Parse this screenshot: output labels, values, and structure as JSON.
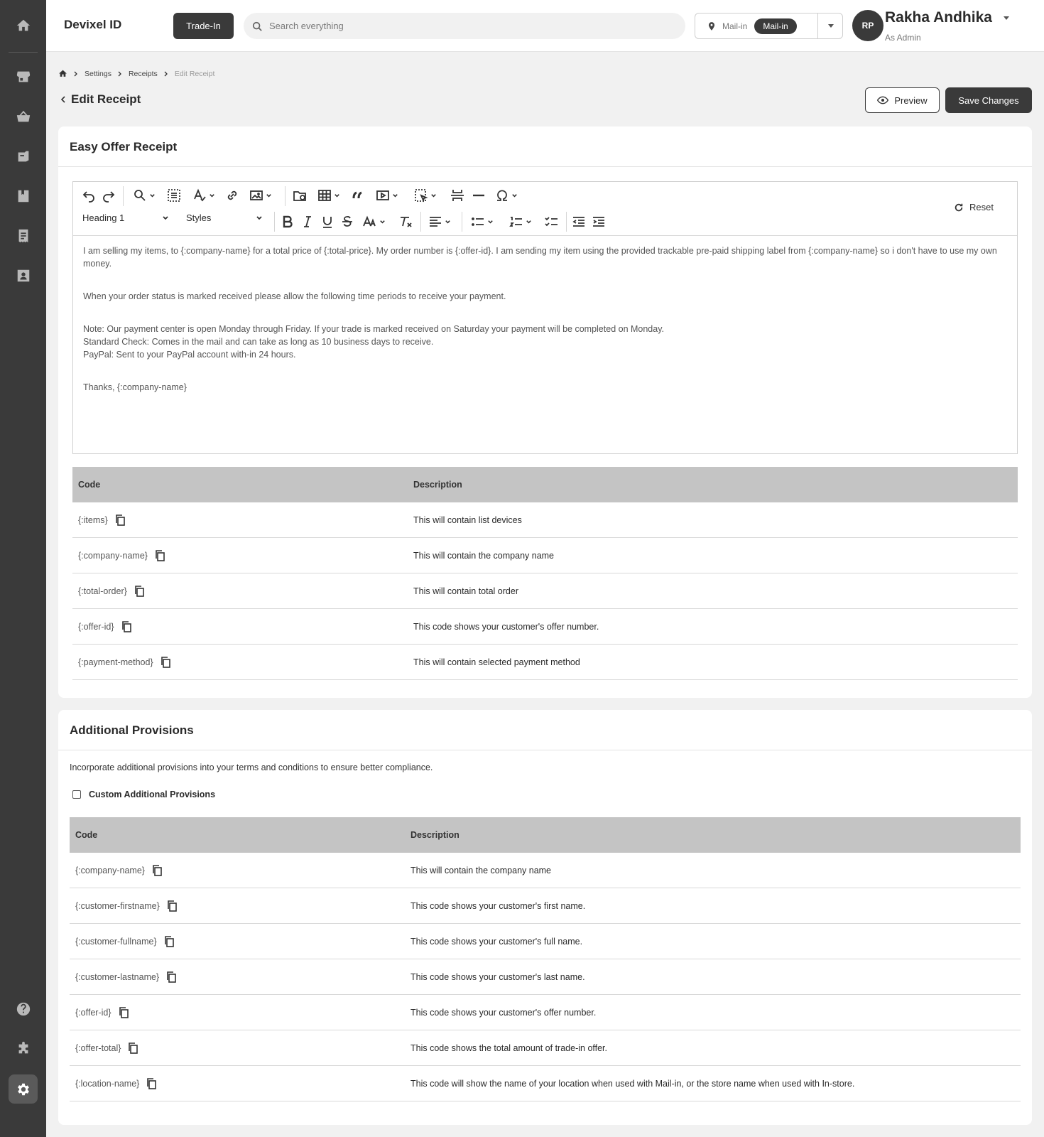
{
  "header": {
    "brand": "Devixel ID",
    "trade_in_label": "Trade-In",
    "search_placeholder": "Search everything",
    "location_label": "Mail-in",
    "location_selected": "Mail-in",
    "user_initials": "RP",
    "user_name": "Rakha Andhika",
    "user_role": "As Admin"
  },
  "sidebar": {
    "icons": [
      "home-icon",
      "store-icon",
      "basket-icon",
      "box-icon",
      "book-icon",
      "receipt-icon",
      "contact-icon",
      "help-icon",
      "puzzle-icon",
      "gear-icon"
    ]
  },
  "breadcrumb": {
    "items": [
      "Settings",
      "Receipts"
    ],
    "current": "Edit Receipt"
  },
  "page": {
    "title": "Edit Receipt",
    "preview_label": "Preview",
    "save_label": "Save Changes"
  },
  "receipt": {
    "title": "Easy Offer Receipt",
    "heading_select": "Heading 1",
    "styles_select": "Styles",
    "reset_label": "Reset",
    "body": {
      "p1": "I am selling my items, to {:company-name} for a total price of {:total-price}. My order number is {:offer-id}. I am sending my item using the provided trackable pre-paid shipping label from {:company-name} so i don't have to use my own money.",
      "p2": "When your order status is marked received please allow the following time periods to receive your payment.",
      "p3a": "Note: Our payment center is open Monday through Friday. If your trade is marked received on Saturday your payment will be completed on Monday.",
      "p3b": "Standard Check: Comes in the mail and can take as long as 10 business days to receive.",
      "p3c": "PayPal: Sent to your PayPal account with-in 24 hours.",
      "p4": "Thanks, {:company-name}"
    },
    "table": {
      "col_code": "Code",
      "col_description": "Description",
      "rows": [
        {
          "code": "{:items}",
          "description": "This will contain list devices"
        },
        {
          "code": "{:company-name}",
          "description": "This will contain the company name"
        },
        {
          "code": "{:total-order}",
          "description": "This will contain total order"
        },
        {
          "code": "{:offer-id}",
          "description": "This code shows your customer's offer number."
        },
        {
          "code": "{:payment-method}",
          "description": "This will contain selected payment method"
        }
      ]
    }
  },
  "provisions": {
    "title": "Additional Provisions",
    "description": "Incorporate additional provisions into your terms and conditions to ensure better compliance.",
    "checkbox_label": "Custom Additional Provisions",
    "table": {
      "col_code": "Code",
      "col_description": "Description",
      "rows": [
        {
          "code": "{:company-name}",
          "description": "This will contain the company name"
        },
        {
          "code": "{:customer-firstname}",
          "description": "This code shows your customer's first name."
        },
        {
          "code": "{:customer-fullname}",
          "description": "This code shows your customer's full name."
        },
        {
          "code": "{:customer-lastname}",
          "description": "This code shows your customer's last name."
        },
        {
          "code": "{:offer-id}",
          "description": "This code shows your customer's offer number."
        },
        {
          "code": "{:offer-total}",
          "description": "This code shows the total amount of trade-in offer."
        },
        {
          "code": "{:location-name}",
          "description": "This code will show the name of your location when used with Mail-in, or the store name when used with In-store."
        }
      ]
    }
  },
  "colors": {
    "sidebar": "#3a3a3a",
    "accent_dark": "#3a3a3a",
    "table_header": "#c4c4c4",
    "background": "#f1f1f1"
  }
}
